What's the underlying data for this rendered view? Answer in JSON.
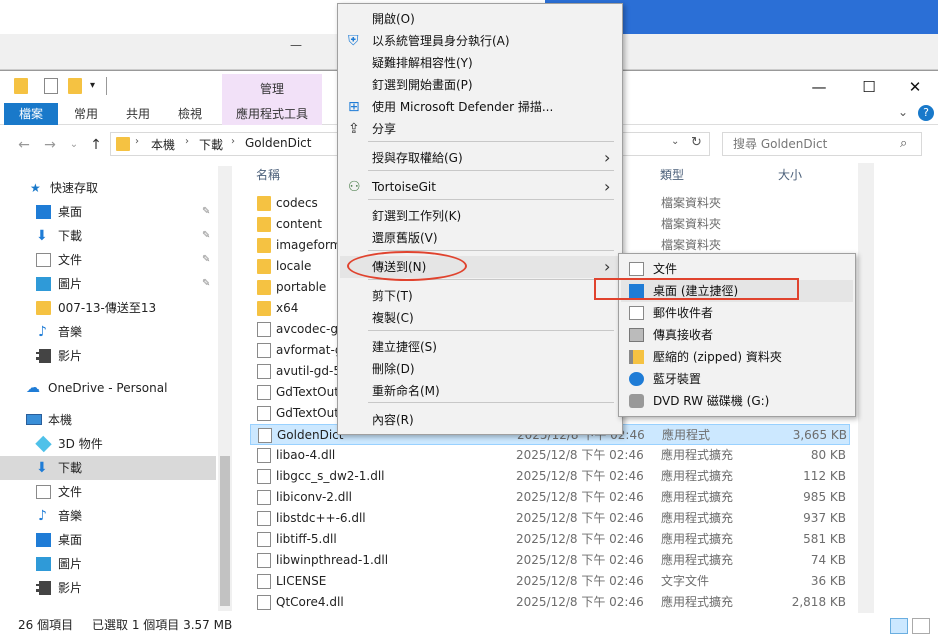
{
  "ribbon": {
    "tabs": [
      "檔案",
      "常用",
      "共用",
      "檢視",
      "應用程式工具"
    ],
    "context_tab": "管理"
  },
  "window": {
    "minimize": "—",
    "maximize": "☐",
    "close": "✕",
    "help": "?"
  },
  "address": {
    "path": [
      "本機",
      "下載",
      "GoldenDict"
    ],
    "search_placeholder": "搜尋 GoldenDict"
  },
  "nav": {
    "quick_access": "快速存取",
    "items": [
      {
        "label": "桌面",
        "pinned": true
      },
      {
        "label": "下載",
        "pinned": true
      },
      {
        "label": "文件",
        "pinned": true
      },
      {
        "label": "圖片",
        "pinned": true
      },
      {
        "label": "007-13-傳送至13",
        "pinned": false
      },
      {
        "label": "音樂",
        "pinned": false
      },
      {
        "label": "影片",
        "pinned": false
      }
    ],
    "onedrive": "OneDrive - Personal",
    "this_pc": "本機",
    "pc_items": [
      "3D 物件",
      "下載",
      "文件",
      "音樂",
      "桌面",
      "圖片",
      "影片"
    ]
  },
  "columns": {
    "name": "名稱",
    "type": "類型",
    "size": "大小"
  },
  "files": [
    {
      "name": "codecs",
      "date": "下午 02:46",
      "type": "檔案資料夾",
      "size": "",
      "kind": "folder"
    },
    {
      "name": "content",
      "date": "下午 02:46",
      "type": "檔案資料夾",
      "size": "",
      "kind": "folder"
    },
    {
      "name": "imageform",
      "date": "下午 02:46",
      "type": "檔案資料夾",
      "size": "",
      "kind": "folder"
    },
    {
      "name": "locale",
      "date": "下午 02:46",
      "type": "檔案資料夾",
      "size": "",
      "kind": "folder"
    },
    {
      "name": "portable",
      "date": "下午 02:46",
      "type": "檔案資料夾",
      "size": "",
      "kind": "folder"
    },
    {
      "name": "x64",
      "date": "下午 02:46",
      "type": "檔案資料夾",
      "size": "",
      "kind": "folder"
    },
    {
      "name": "avcodec-g",
      "date": "下午 02:46",
      "type": "",
      "size": "",
      "kind": "file"
    },
    {
      "name": "avformat-g",
      "date": "下午 02:46",
      "type": "",
      "size": "",
      "kind": "file"
    },
    {
      "name": "avutil-gd-5",
      "date": "下午 02:46",
      "type": "",
      "size": "",
      "kind": "file"
    },
    {
      "name": "GdTextOut",
      "date": "下午 02:46",
      "type": "",
      "size": "",
      "kind": "file"
    },
    {
      "name": "GdTextOut",
      "date": "下午 02:46",
      "type": "",
      "size": "",
      "kind": "file"
    },
    {
      "name": "GoldenDict",
      "date": "2025/12/8 下午 02:46",
      "type": "應用程式",
      "size": "3,665 KB",
      "kind": "app"
    },
    {
      "name": "libao-4.dll",
      "date": "2025/12/8 下午 02:46",
      "type": "應用程式擴充",
      "size": "80 KB",
      "kind": "file"
    },
    {
      "name": "libgcc_s_dw2-1.dll",
      "date": "2025/12/8 下午 02:46",
      "type": "應用程式擴充",
      "size": "112 KB",
      "kind": "file"
    },
    {
      "name": "libiconv-2.dll",
      "date": "2025/12/8 下午 02:46",
      "type": "應用程式擴充",
      "size": "985 KB",
      "kind": "file"
    },
    {
      "name": "libstdc++-6.dll",
      "date": "2025/12/8 下午 02:46",
      "type": "應用程式擴充",
      "size": "937 KB",
      "kind": "file"
    },
    {
      "name": "libtiff-5.dll",
      "date": "2025/12/8 下午 02:46",
      "type": "應用程式擴充",
      "size": "581 KB",
      "kind": "file"
    },
    {
      "name": "libwinpthread-1.dll",
      "date": "2025/12/8 下午 02:46",
      "type": "應用程式擴充",
      "size": "74 KB",
      "kind": "file"
    },
    {
      "name": "LICENSE",
      "date": "2025/12/8 下午 02:46",
      "type": "文字文件",
      "size": "36 KB",
      "kind": "file"
    },
    {
      "name": "QtCore4.dll",
      "date": "2025/12/8 下午 02:46",
      "type": "應用程式擴充",
      "size": "2,818 KB",
      "kind": "file"
    }
  ],
  "status": {
    "count": "26 個項目",
    "selected": "已選取 1 個項目 3.57 MB"
  },
  "context_menu": {
    "items": [
      "開啟(O)",
      "以系統管理員身分執行(A)",
      "疑難排解相容性(Y)",
      "釘選到開始畫面(P)",
      "使用 Microsoft Defender 掃描...",
      "分享",
      "授與存取權給(G)",
      "TortoiseGit",
      "釘選到工作列(K)",
      "還原舊版(V)",
      "傳送到(N)",
      "剪下(T)",
      "複製(C)",
      "建立捷徑(S)",
      "刪除(D)",
      "重新命名(M)",
      "內容(R)"
    ]
  },
  "submenu": {
    "items": [
      "文件",
      "桌面 (建立捷徑)",
      "郵件收件者",
      "傳真接收者",
      "壓縮的 (zipped) 資料夾",
      "藍牙裝置",
      "DVD RW 磁碟機 (G:)"
    ]
  },
  "colors": {
    "accent": "#1979ca",
    "selection": "#cce8ff",
    "manage_tab": "#f2e1f8",
    "annotation": "#e0432e"
  }
}
